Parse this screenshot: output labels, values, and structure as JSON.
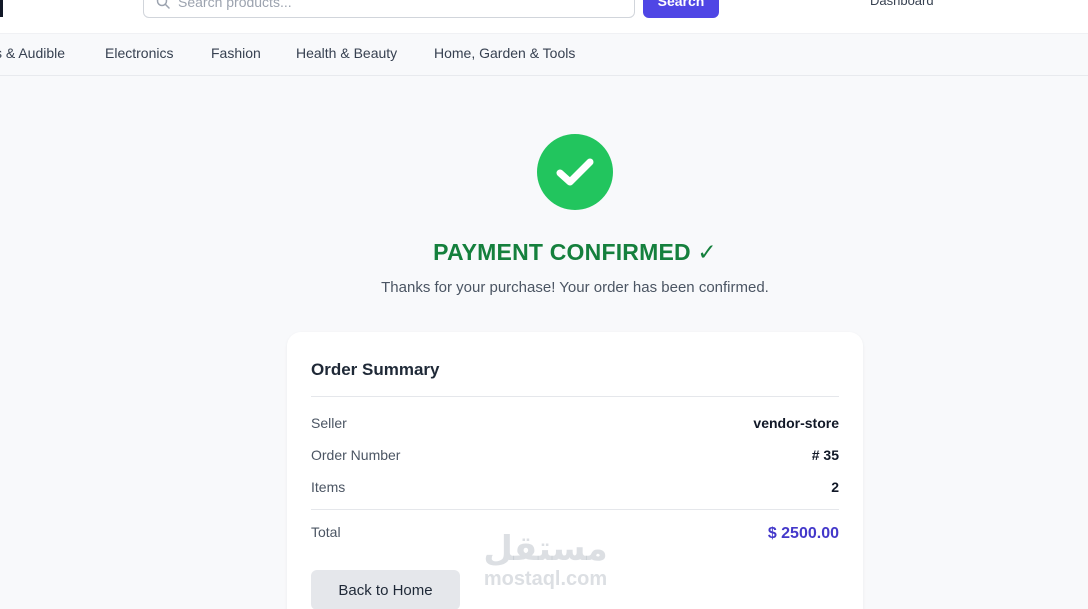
{
  "header": {
    "search": {
      "placeholder": "Search products...",
      "button_label": "Search"
    },
    "dashboard_label": "Dashboard"
  },
  "categories": [
    "s & Audible",
    "Electronics",
    "Fashion",
    "Health & Beauty",
    "Home, Garden & Tools"
  ],
  "confirmation": {
    "title": "PAYMENT CONFIRMED ✓",
    "message": "Thanks for your purchase! Your order has been confirmed."
  },
  "summary": {
    "title": "Order Summary",
    "rows": [
      {
        "label": "Seller",
        "value": "vendor-store"
      },
      {
        "label": "Order Number",
        "value": "# 35"
      },
      {
        "label": "Items",
        "value": "2"
      }
    ],
    "total": {
      "label": "Total",
      "value": "$ 2500.00"
    },
    "back_button": "Back to Home"
  },
  "watermark": {
    "arabic": "مستقل",
    "latin": "mostaql.com"
  },
  "colors": {
    "accent": "#4f46e5",
    "success": "#22c55e",
    "success_text": "#15803d",
    "total_text": "#4338ca"
  },
  "icons": {
    "search": "search-icon",
    "check": "checkmark-icon"
  }
}
